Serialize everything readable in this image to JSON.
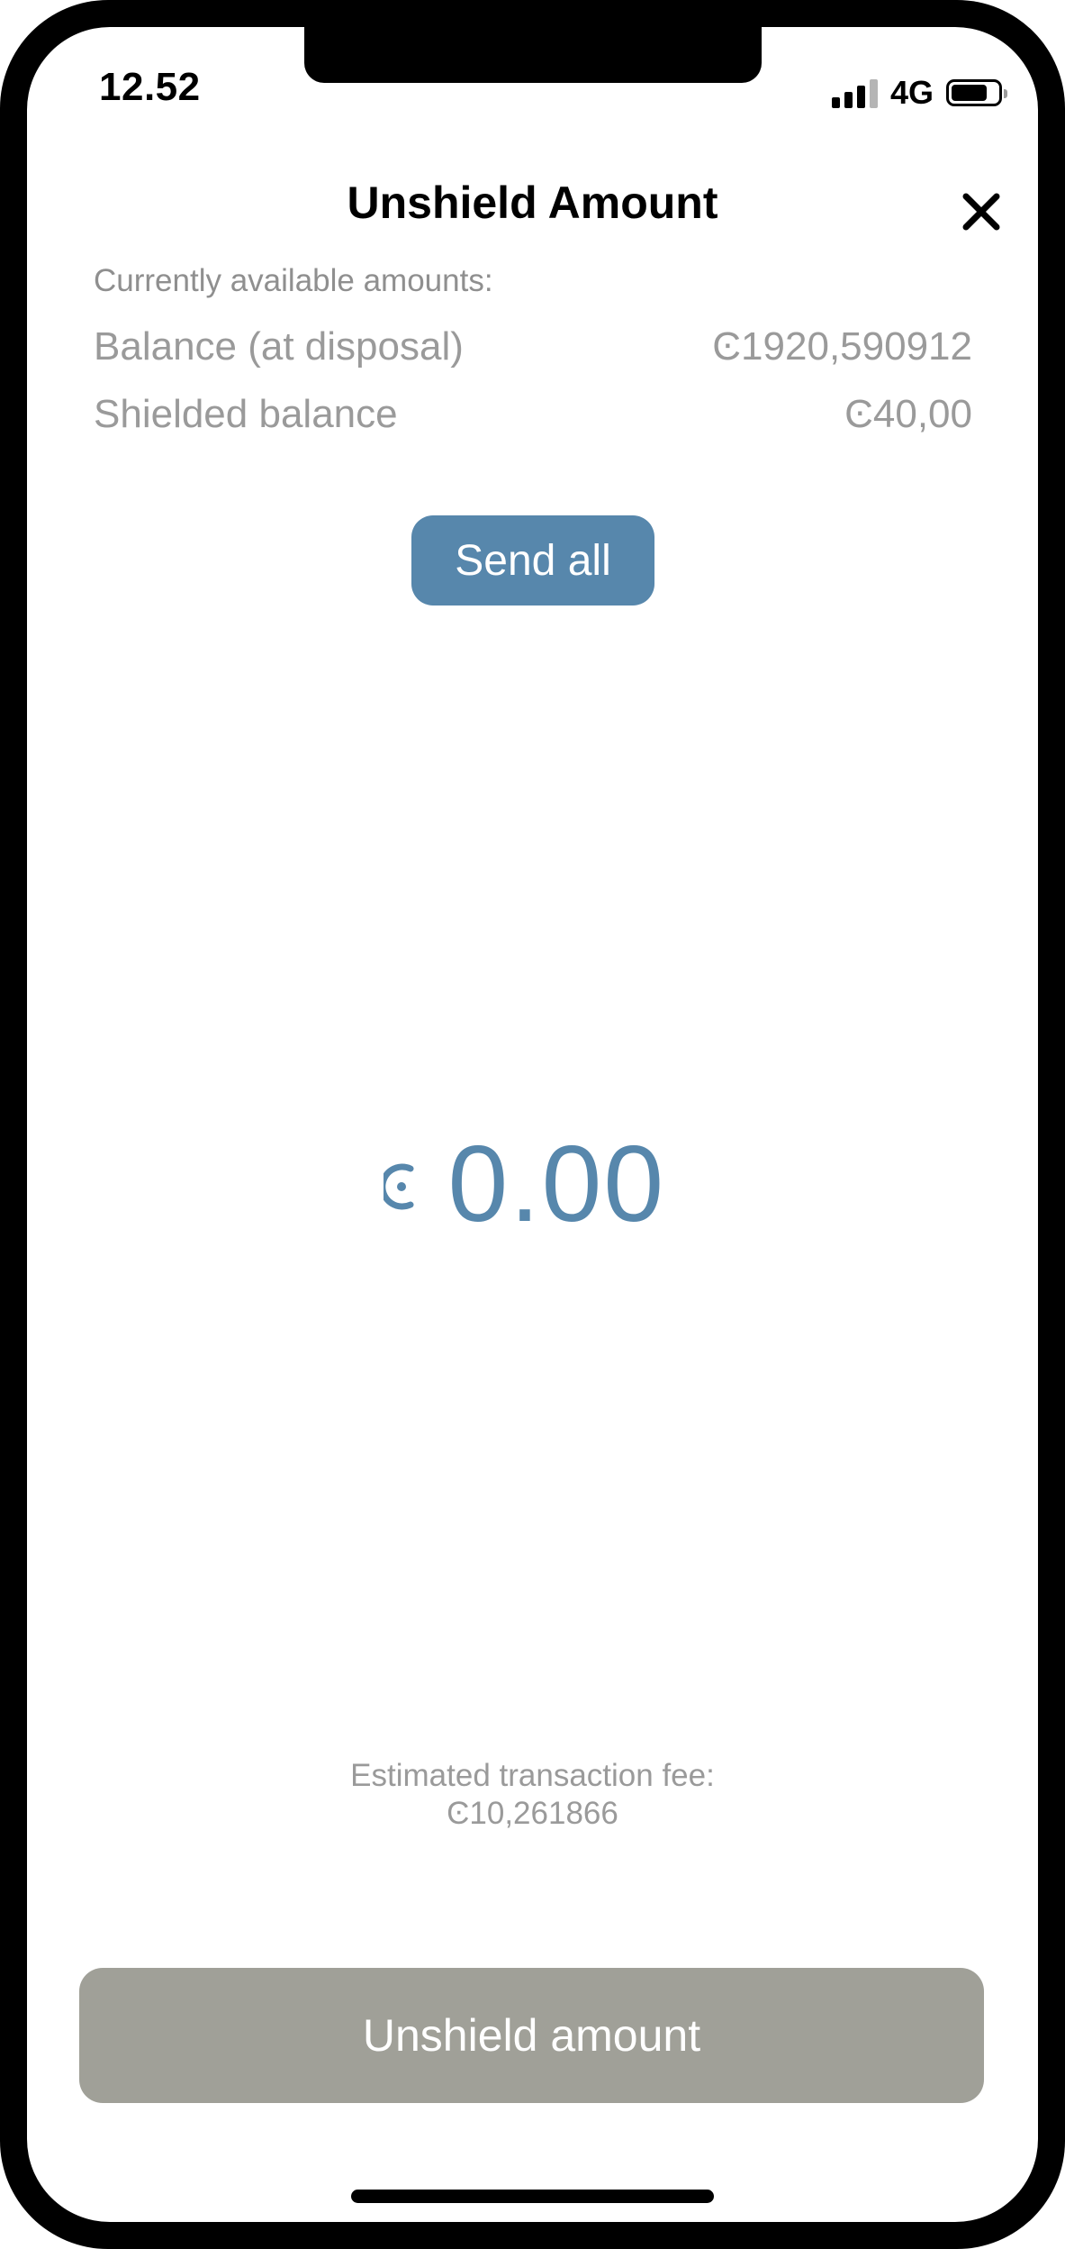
{
  "status_bar": {
    "time": "12.52",
    "network": "4G",
    "icons": [
      "signal-icon",
      "battery-icon"
    ]
  },
  "header": {
    "title": "Unshield Amount",
    "close_icon": "close-icon"
  },
  "available": {
    "label": "Currently available amounts:",
    "rows": [
      {
        "label": "Balance (at disposal)",
        "value": "Ͼ1920,590912"
      },
      {
        "label": "Shielded balance",
        "value": "Ͼ40,00"
      }
    ]
  },
  "send_all_label": "Send all",
  "amount": {
    "currency_icon": "ccd-icon",
    "value": "0.00"
  },
  "fee": {
    "label": "Estimated transaction fee:",
    "value": "Ͼ10,261866"
  },
  "primary_button_label": "Unshield amount",
  "colors": {
    "accent": "#5787ac",
    "disabled_button": "#a0a098",
    "secondary_text": "#9a9a9a"
  }
}
